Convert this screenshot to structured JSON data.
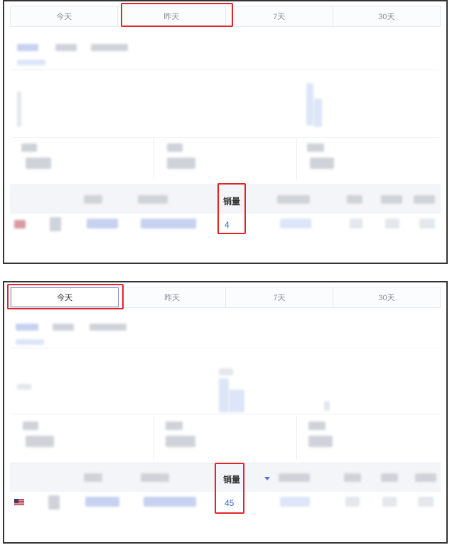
{
  "screen1": {
    "tabs": [
      {
        "label": "今天"
      },
      {
        "label": "昨天"
      },
      {
        "label": "7天"
      },
      {
        "label": "30天"
      }
    ],
    "active_tab": "昨天",
    "table": {
      "sales_header": "销量",
      "sales_value": "4"
    }
  },
  "screen2": {
    "tabs": [
      {
        "label": "今天"
      },
      {
        "label": "昨天"
      },
      {
        "label": "7天"
      },
      {
        "label": "30天"
      }
    ],
    "active_tab": "今天",
    "table": {
      "sales_header": "销量",
      "sales_value": "45"
    }
  },
  "colors": {
    "highlight": "#e0262b",
    "link": "#3366cc",
    "active_tab_border": "#7b86c8"
  },
  "icons": [
    "us-flag-icon",
    "sort-desc-icon"
  ]
}
